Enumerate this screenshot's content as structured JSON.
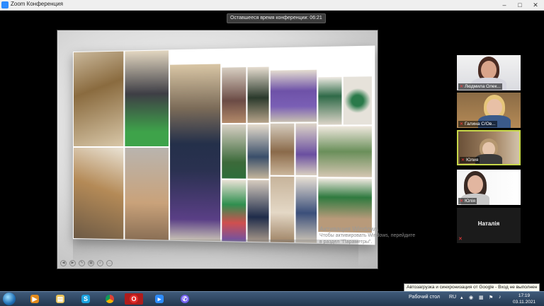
{
  "window": {
    "title": "Zoom Конференция",
    "controls": [
      "–",
      "□",
      "✕"
    ]
  },
  "meeting": {
    "remaining_time": "Оставшееся время конференции: 06:21"
  },
  "shared_screen": {
    "watermark_title": "Активация Windows",
    "watermark_body": "Чтобы активировать Windows, перейдите в раздел \"Параметры\"."
  },
  "participants": [
    {
      "name": "Людмила Олек...",
      "muted": true
    },
    {
      "name": "Галина С/Ов...",
      "muted": true
    },
    {
      "name": "Юлия",
      "muted": true
    },
    {
      "name": "Юлія",
      "muted": true
    },
    {
      "name": "Наталія",
      "muted": true
    }
  ],
  "tooltip": "Автозагрузка и синхронизация от Google - Вход не выполнен",
  "taskbar": {
    "apps": [
      "windows-explorer-icon",
      "media-player-icon",
      "file-explorer-icon",
      "skype-icon",
      "chrome-icon",
      "opera-icon",
      "zoom-icon",
      "viber-icon"
    ],
    "desktop_label": "Рабочий стол",
    "language": "RU",
    "time": "17:19",
    "date": "03.11.2021"
  },
  "colors": {
    "zoom_blue": "#2d8cff",
    "active_speaker_border": "#c8d84a",
    "taskbar": "#2c4460"
  }
}
